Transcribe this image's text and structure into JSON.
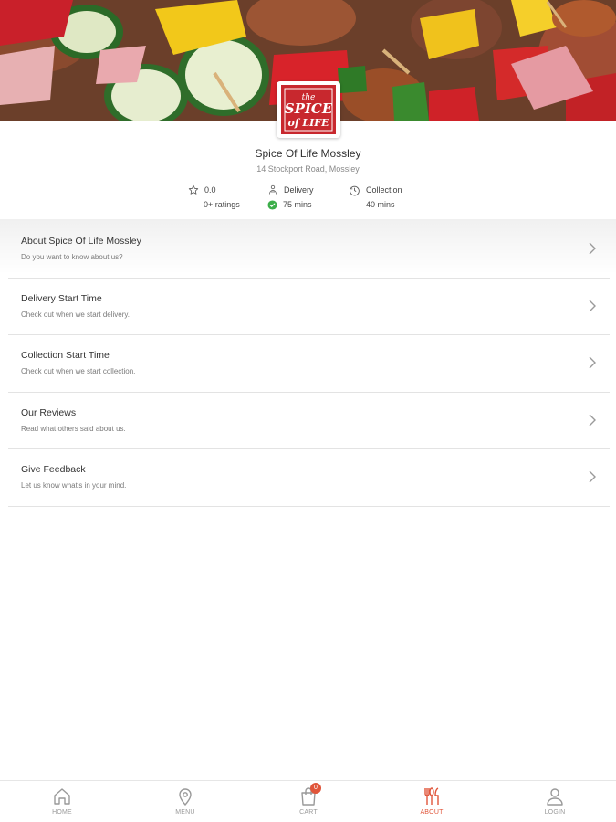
{
  "restaurant": {
    "name": "Spice Of Life Mossley",
    "address": "14 Stockport Road, Mossley",
    "logo_text": [
      "the",
      "SPICE",
      "of LIFE"
    ]
  },
  "stats": {
    "rating_value": "0.0",
    "rating_count": "0+ ratings",
    "delivery_label": "Delivery",
    "delivery_time": "75 mins",
    "collection_label": "Collection",
    "collection_time": "40 mins"
  },
  "menu_items": [
    {
      "title": "About Spice Of Life Mossley",
      "subtitle": "Do you want to know about us?"
    },
    {
      "title": "Delivery Start Time",
      "subtitle": "Check out when we start delivery."
    },
    {
      "title": "Collection Start Time",
      "subtitle": "Check out when we start collection."
    },
    {
      "title": "Our Reviews",
      "subtitle": "Read what others said about us."
    },
    {
      "title": "Give Feedback",
      "subtitle": "Let us know what's in your mind."
    }
  ],
  "bottom_nav": {
    "home": "HOME",
    "menu": "MENU",
    "cart": "CART",
    "cart_count": "0",
    "about": "ABOUT",
    "login": "LOGIN"
  },
  "icons": {
    "rating": "star-icon",
    "delivery": "delivery-person-icon",
    "delivery_status": "check-circle-icon",
    "collection": "clock-history-icon",
    "chevron": "chevron-right-icon",
    "home": "home-icon",
    "menu": "map-pin-icon",
    "cart": "shopping-bag-icon",
    "about": "cutlery-icon",
    "login": "user-icon"
  },
  "colors": {
    "accent": "#e0553a",
    "logo_red": "#c8282e",
    "success": "#3cae4a",
    "divider": "#e3e3e3"
  }
}
